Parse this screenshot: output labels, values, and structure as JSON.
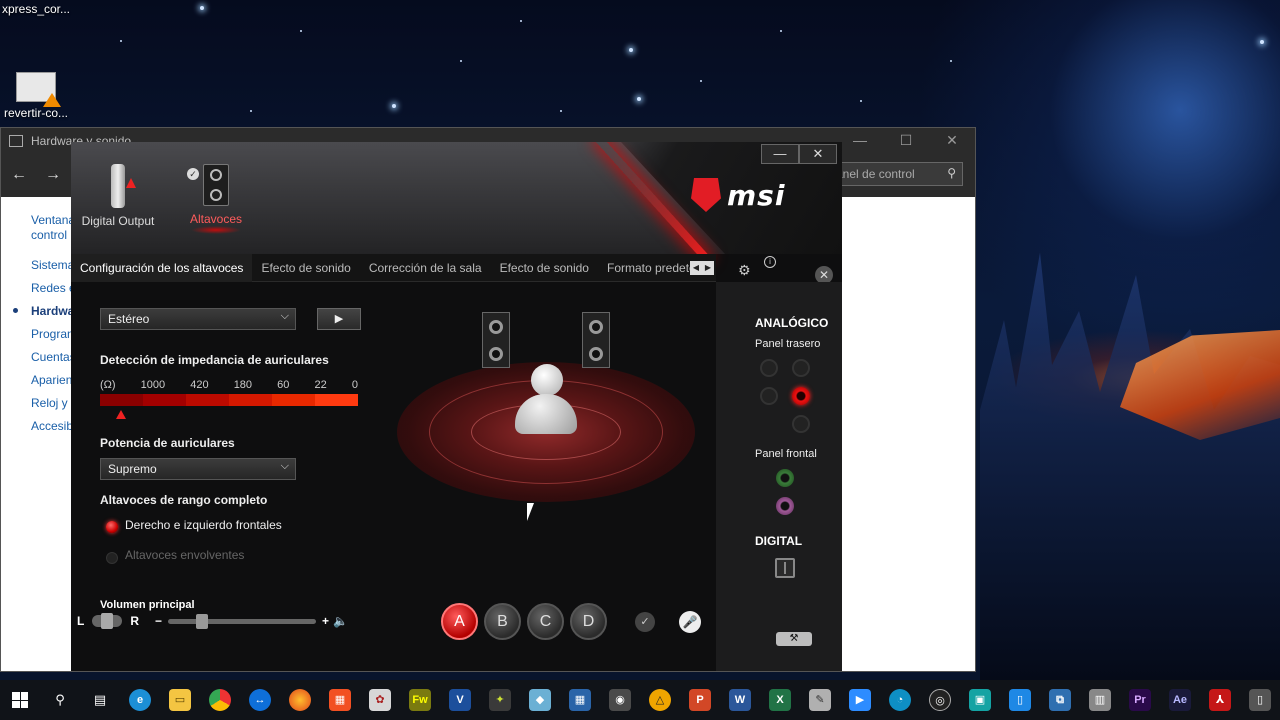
{
  "desktop": {
    "icons": [
      {
        "label": "xpress_cor..."
      },
      {
        "label": "revertir-co..."
      }
    ]
  },
  "bg_window": {
    "title": "Hardware y sonido",
    "controls": [
      "—",
      "☐",
      "✕"
    ],
    "search_placeholder": "anel de control",
    "nav_items": [
      "Ventana",
      "control",
      "Sistema",
      "Redes e",
      "Hardwa",
      "Progran",
      "Cuentas",
      "Aparien",
      "Reloj y r",
      "Accesib"
    ]
  },
  "msi": {
    "devices": [
      {
        "label": "Digital Output",
        "active": false
      },
      {
        "label": "Altavoces",
        "active": true
      }
    ],
    "logo_text": "msi",
    "window_controls": {
      "minimize": "—",
      "close": "✕"
    },
    "tabs": [
      {
        "label": "Configuración de los altavoces",
        "active": true
      },
      {
        "label": "Efecto de sonido"
      },
      {
        "label": "Corrección de la sala"
      },
      {
        "label": "Efecto de sonido"
      },
      {
        "label": "Formato predeterm"
      }
    ],
    "speaker_config": {
      "selected": "Estéreo",
      "play_icon": "▶"
    },
    "impedance": {
      "title": "Detección de impedancia de auriculares",
      "scale": [
        "(Ω)",
        "1000",
        "420",
        "180",
        "60",
        "22",
        "0"
      ],
      "bar_colors": [
        "#8a0000",
        "#a30000",
        "#bc0a00",
        "#d41800",
        "#e82800",
        "#ff3a10"
      ],
      "marker_index": 1
    },
    "headphone_power": {
      "title": "Potencia de auriculares",
      "selected": "Supremo"
    },
    "fullrange": {
      "title": "Altavoces de rango completo",
      "options": [
        {
          "label": "Derecho e izquierdo frontales",
          "on": true
        },
        {
          "label": "Altavoces envolventes",
          "on": false
        }
      ]
    },
    "volume": {
      "title": "Volumen principal",
      "left": "L",
      "right": "R",
      "minus": "−",
      "plus": "+",
      "speaker_icon": "🔈"
    },
    "presets": [
      "A",
      "B",
      "C",
      "D"
    ],
    "active_preset": "A",
    "right_panel": {
      "analog": "ANALÓGICO",
      "rear": "Panel trasero",
      "front": "Panel frontal",
      "digital": "DIGITAL"
    },
    "accent": "#e21d25"
  },
  "taskbar": {
    "apps": [
      "start",
      "search",
      "task-view",
      "edge",
      "explorer",
      "chrome",
      "teamviewer",
      "firefox",
      "store",
      "app",
      "fireworks",
      "visio",
      "app2",
      "app3",
      "calculator",
      "camera",
      "app4",
      "powerpoint",
      "word",
      "excel",
      "app5",
      "zoom",
      "app6",
      "obs",
      "app7",
      "app8",
      "app9",
      "app10",
      "premiere",
      "aftereffects",
      "acrobat",
      "app11"
    ]
  }
}
